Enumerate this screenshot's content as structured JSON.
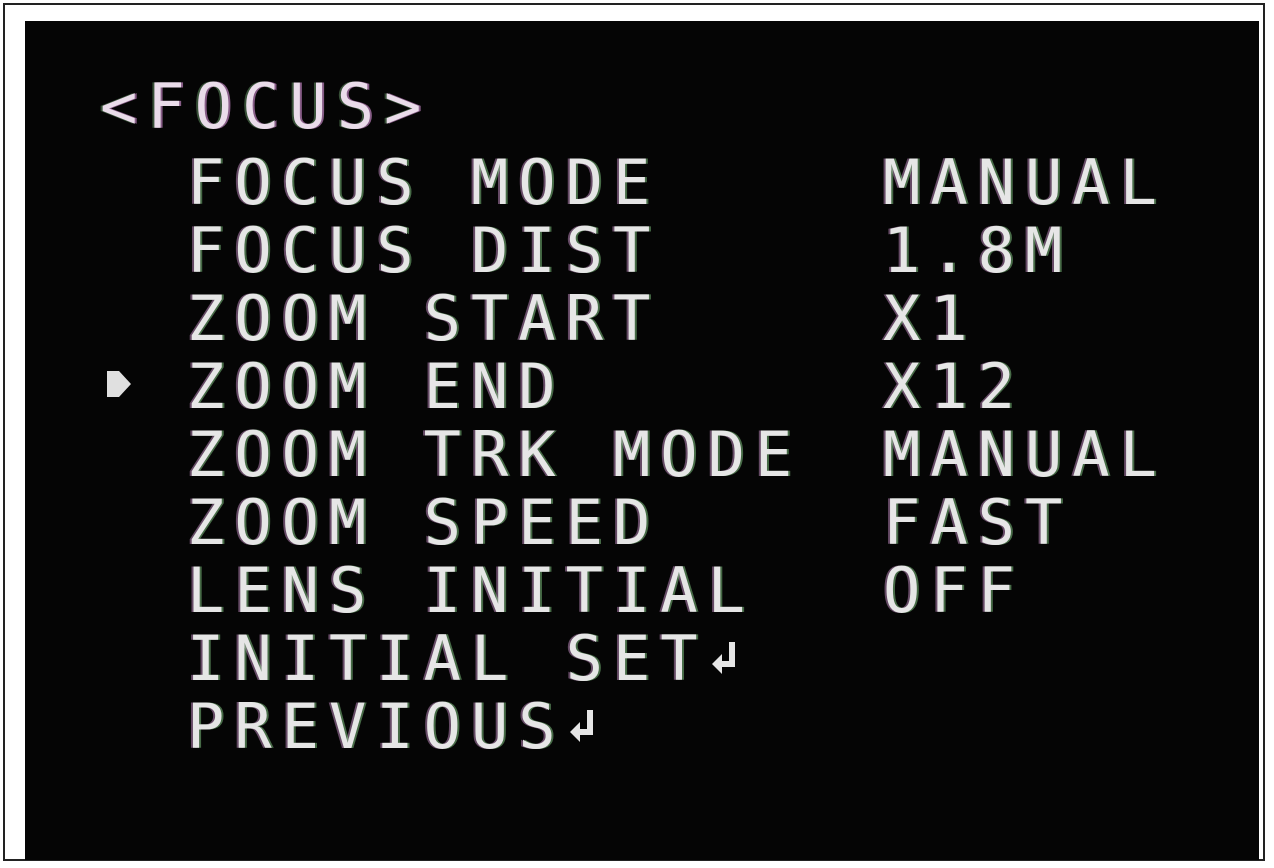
{
  "title": "<FOCUS>",
  "cursor_icon": "triangle-right-icon",
  "enter_icon": "enter-return-icon",
  "items": [
    {
      "label": "FOCUS MODE",
      "value": "MANUAL"
    },
    {
      "label": "FOCUS DIST",
      "value": "1.8M",
      "selected": true
    },
    {
      "label": "ZOOM START",
      "value": "X1"
    },
    {
      "label": "ZOOM END",
      "value": "X12"
    },
    {
      "label": "ZOOM TRK MODE",
      "value": "MANUAL"
    },
    {
      "label": "ZOOM SPEED",
      "value": "FAST"
    },
    {
      "label": "LENS INITIAL",
      "value": "OFF"
    },
    {
      "label": "INITIAL SET",
      "value": ""
    },
    {
      "label": "PREVIOUS",
      "value": ""
    }
  ],
  "colors": {
    "background": "#050505",
    "text": "#e6e6e6",
    "frame": "#222222"
  }
}
